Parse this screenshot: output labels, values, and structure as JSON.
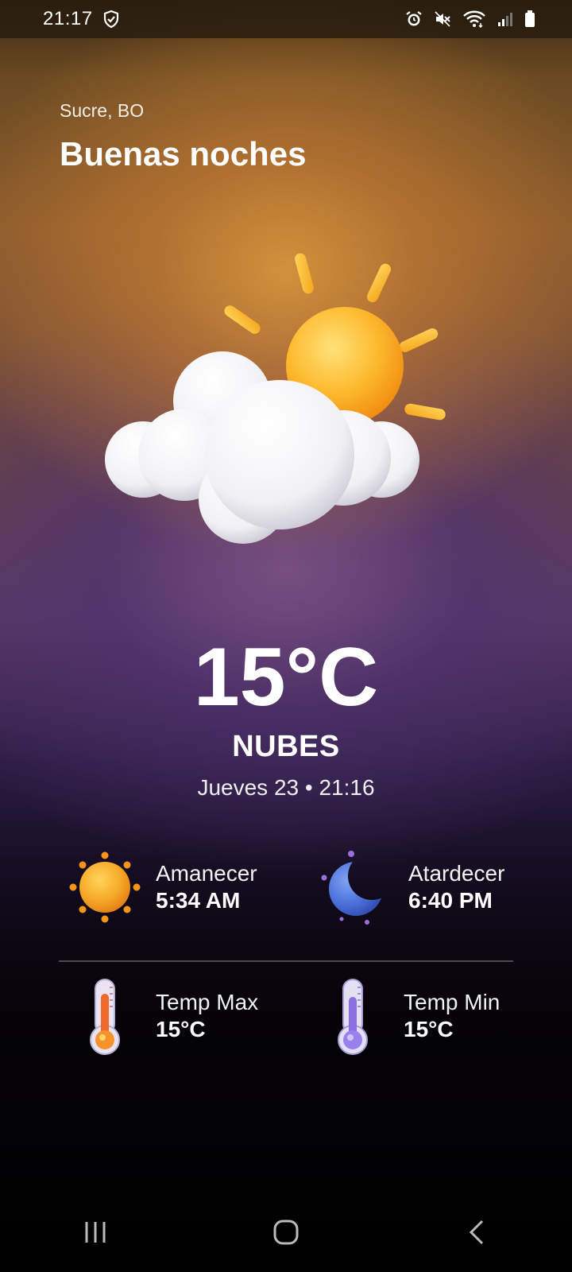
{
  "status_bar": {
    "time": "21:17",
    "icons": [
      "shield-check-icon",
      "alarm-icon",
      "mute-icon",
      "wifi-icon",
      "signal-icon",
      "battery-icon"
    ]
  },
  "header": {
    "location": "Sucre, BO",
    "greeting": "Buenas noches"
  },
  "current": {
    "icon": "partly-cloudy-icon",
    "temperature": "15°C",
    "condition": "NUBES",
    "datetime": "Jueves 23 • 21:16"
  },
  "details": {
    "sunrise": {
      "label": "Amanecer",
      "value": "5:34 AM",
      "icon": "sunrise-sun-icon"
    },
    "sunset": {
      "label": "Atardecer",
      "value": "6:40 PM",
      "icon": "moon-icon"
    },
    "temp_max": {
      "label": "Temp Max",
      "value": "15°C",
      "icon": "thermometer-hot-icon"
    },
    "temp_min": {
      "label": "Temp Min",
      "value": "15°C",
      "icon": "thermometer-cold-icon"
    }
  },
  "nav": {
    "buttons": [
      "recents-button",
      "home-button",
      "back-button"
    ]
  },
  "colors": {
    "sun": "#FDB92E",
    "moon": "#4A6FD8",
    "background_top": "#8A5A2C",
    "background_mid": "#5A3A66",
    "background_bottom": "#000000"
  }
}
